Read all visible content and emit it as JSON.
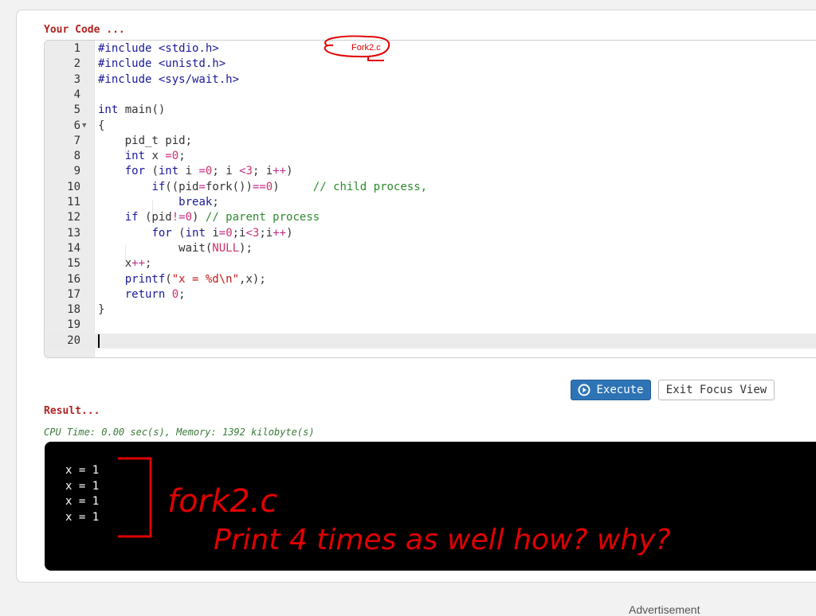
{
  "code_section": {
    "title": "Your Code ..."
  },
  "editor": {
    "lines": [
      {
        "n": "1",
        "html": "<span class=\"pp\">#include &lt;stdio.h&gt;</span>"
      },
      {
        "n": "2",
        "html": "<span class=\"pp\">#include &lt;unistd.h&gt;</span>"
      },
      {
        "n": "3",
        "html": "<span class=\"pp\">#include &lt;sys/wait.h&gt;</span>"
      },
      {
        "n": "4",
        "html": ""
      },
      {
        "n": "5",
        "html": "<span class=\"kw\">int</span> main()"
      },
      {
        "n": "6",
        "html": "{",
        "fold": true
      },
      {
        "n": "7",
        "html": "    pid_t pid;"
      },
      {
        "n": "8",
        "html": "    <span class=\"kw\">int</span> x <span class=\"op\">=</span><span class=\"num\">0</span>;"
      },
      {
        "n": "9",
        "html": "    <span class=\"kw\">for</span> (<span class=\"kw\">int</span> i <span class=\"op\">=</span><span class=\"num\">0</span>; i <span class=\"op\">&lt;</span><span class=\"num\">3</span>; i<span class=\"op\">++</span>)"
      },
      {
        "n": "10",
        "html": "        <span class=\"kw\">if</span>((pid<span class=\"op\">=</span>fork())<span class=\"op\">==</span><span class=\"num\">0</span>)     <span class=\"cm\">// child process,</span>"
      },
      {
        "n": "11",
        "html": "            <span class=\"kw\">break</span>;"
      },
      {
        "n": "12",
        "html": "    <span class=\"kw\">if</span> (pid<span class=\"op\">!=</span><span class=\"num\">0</span>) <span class=\"cm\">// parent process</span>"
      },
      {
        "n": "13",
        "html": "        <span class=\"kw\">for</span> (<span class=\"kw\">int</span> i<span class=\"op\">=</span><span class=\"num\">0</span>;i<span class=\"op\">&lt;</span><span class=\"num\">3</span>;i<span class=\"op\">++</span>)"
      },
      {
        "n": "14",
        "html": "            wait(<span class=\"num\">NULL</span>);"
      },
      {
        "n": "15",
        "html": "    x<span class=\"op\">++</span>;"
      },
      {
        "n": "16",
        "html": "    <span class=\"kw\">printf</span>(<span class=\"str\">\"x = %d\\n\"</span>,x);"
      },
      {
        "n": "17",
        "html": "    <span class=\"kw\">return</span> <span class=\"num\">0</span>;"
      },
      {
        "n": "18",
        "html": "}"
      },
      {
        "n": "19",
        "html": ""
      },
      {
        "n": "20",
        "html": "",
        "active": true
      }
    ]
  },
  "buttons": {
    "execute": "Execute",
    "exit_focus": "Exit Focus View"
  },
  "result_section": {
    "title": "Result...",
    "meta": "CPU Time: 0.00 sec(s), Memory: 1392 kilobyte(s)",
    "output": [
      "x = 1",
      "x = 1",
      "x = 1",
      "x = 1"
    ]
  },
  "annotations": {
    "file_tag": "Fork2.c",
    "note_line1": "fork2.c",
    "note_line2": "Print 4 times as well how? why?"
  },
  "footer": {
    "advertisement": "Advertisement"
  },
  "colors": {
    "accent": "#2e74b5",
    "title_red": "#b22222",
    "annotation_red": "#e00000"
  }
}
